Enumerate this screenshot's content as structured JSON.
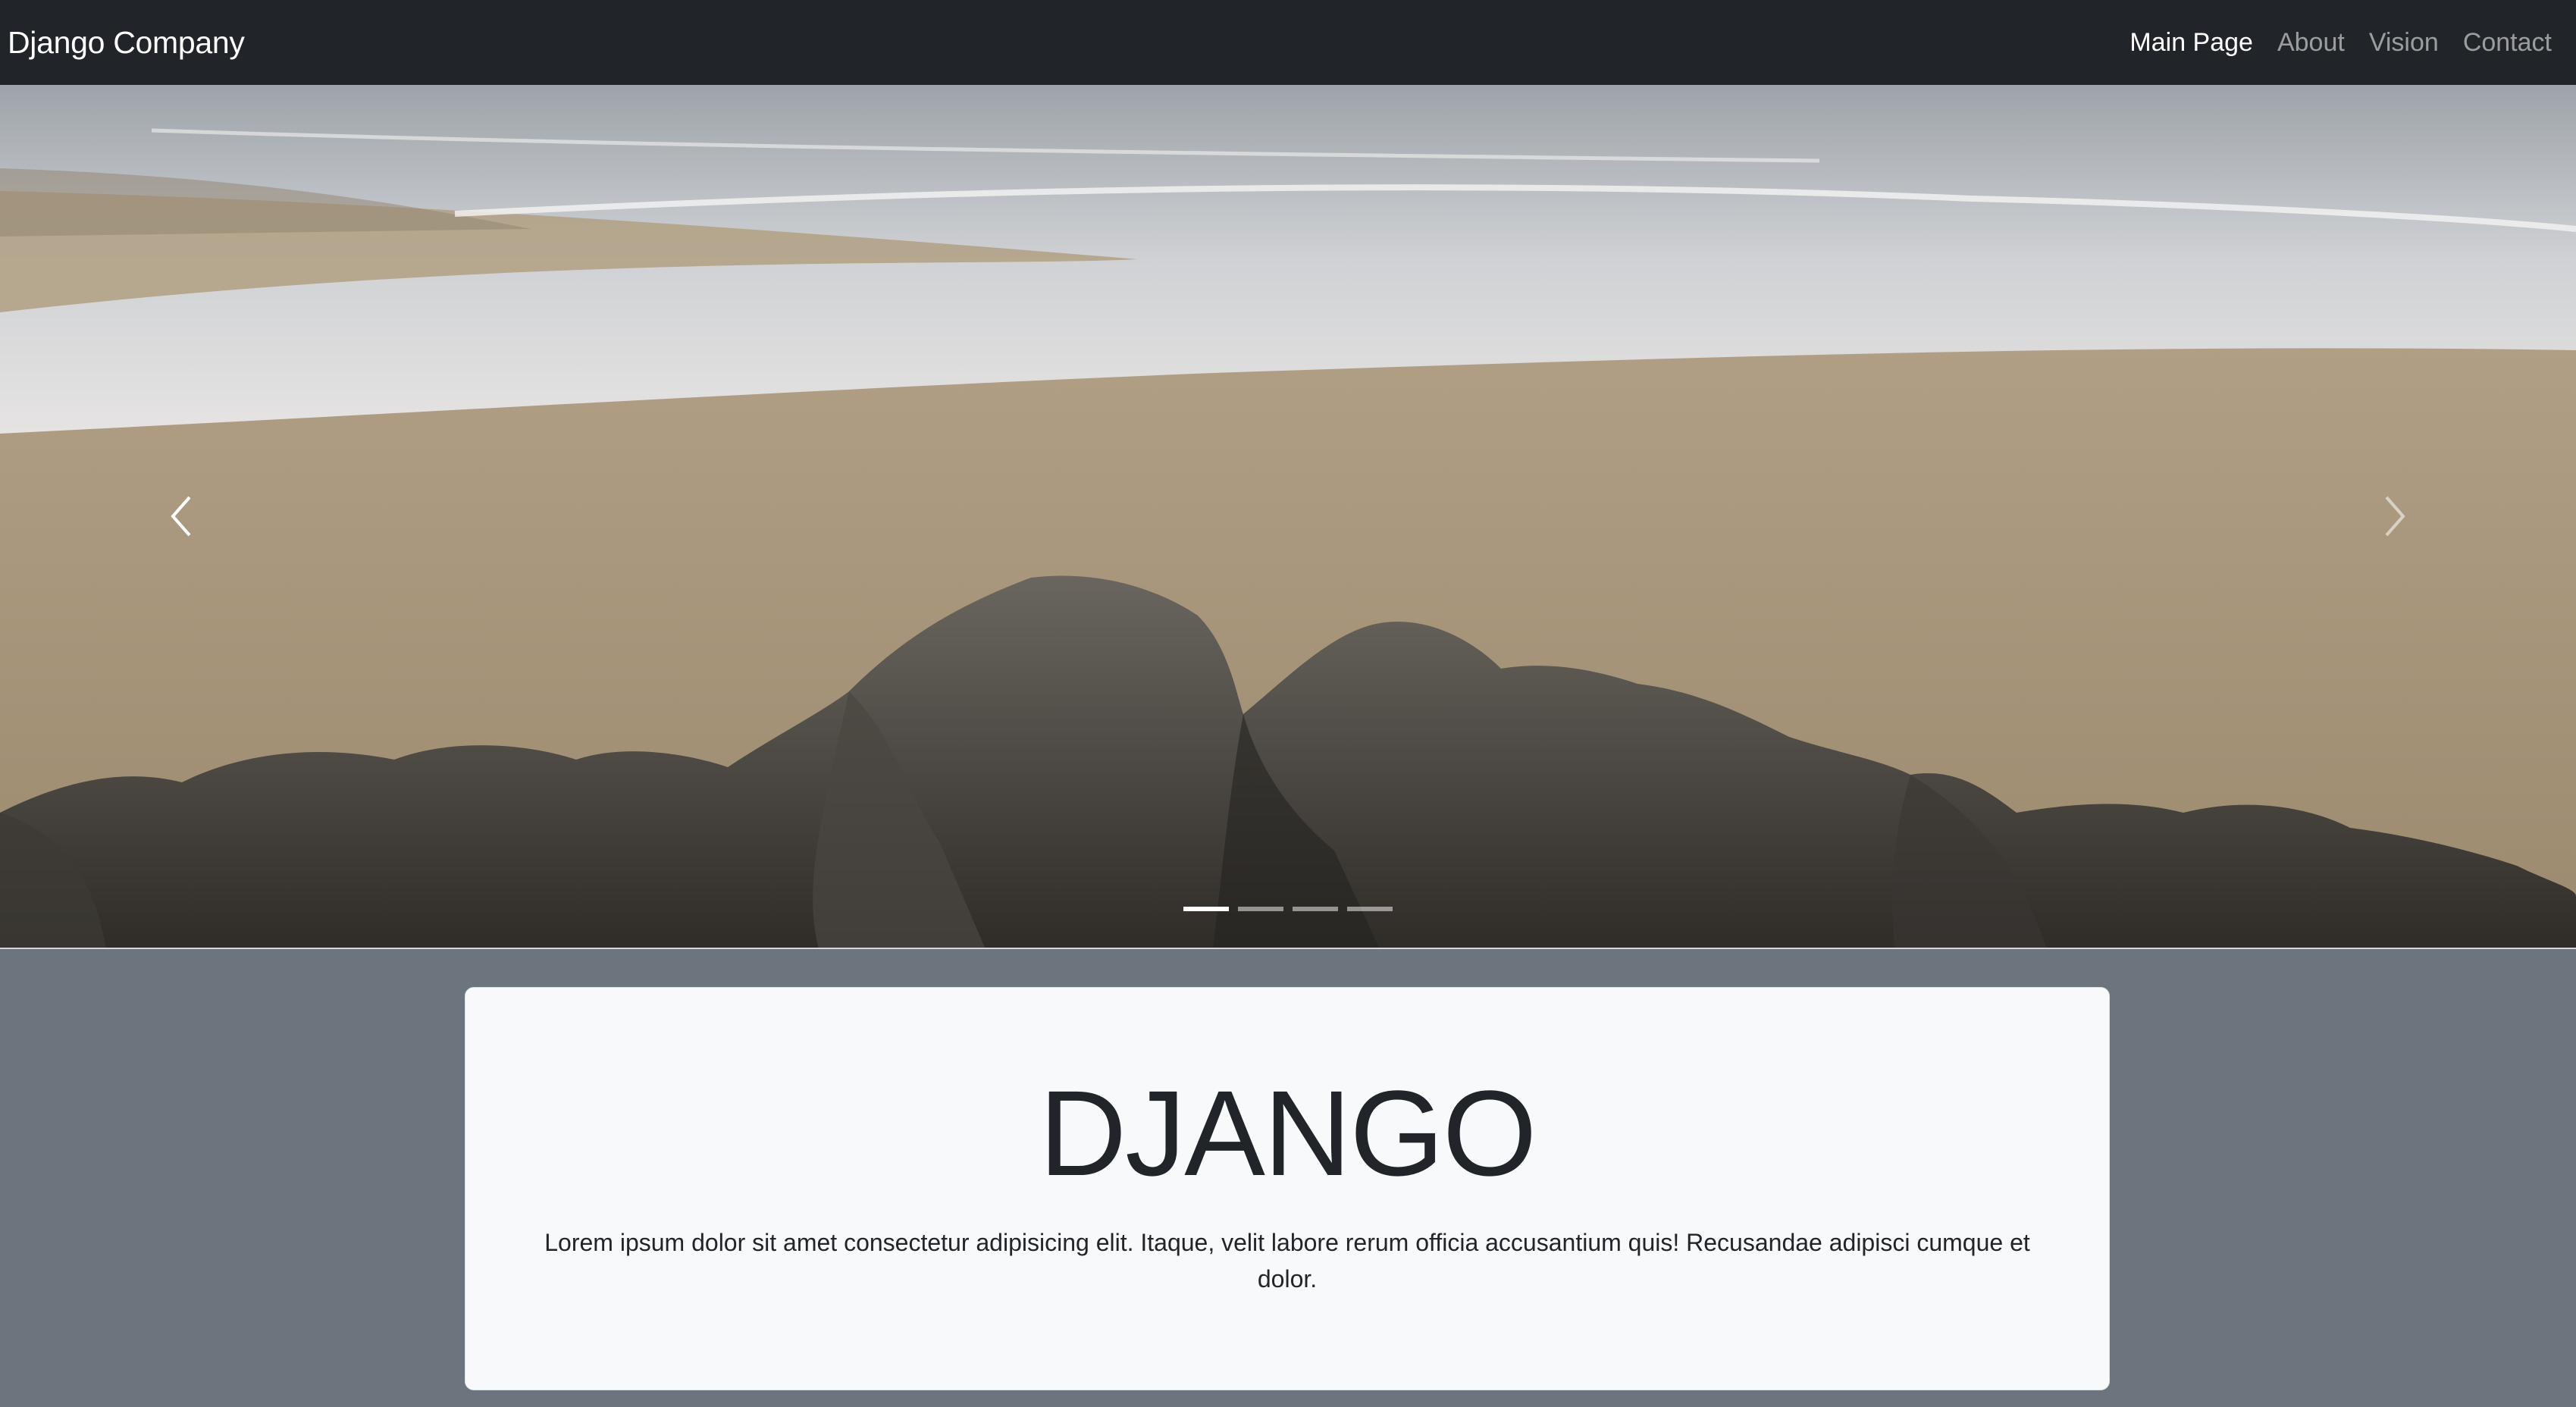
{
  "navbar": {
    "brand": "Django Company",
    "links": [
      {
        "label": "Main Page",
        "active": true
      },
      {
        "label": "About",
        "active": false
      },
      {
        "label": "Vision",
        "active": false
      },
      {
        "label": "Contact",
        "active": false
      }
    ]
  },
  "carousel": {
    "slide_count": 4,
    "active_slide": 1,
    "prev_icon": "chevron-left-icon",
    "next_icon": "chevron-right-icon"
  },
  "hero_card": {
    "title": "DJANGO",
    "text": "Lorem ipsum dolor sit amet consectetur adipisicing elit. Itaque, velit labore rerum officia accusantium quis! Recusandae adipisci cumque et dolor."
  },
  "colors": {
    "navbar_bg": "#212529",
    "page_bg": "#6c757d",
    "card_bg": "#f8f9fa"
  }
}
